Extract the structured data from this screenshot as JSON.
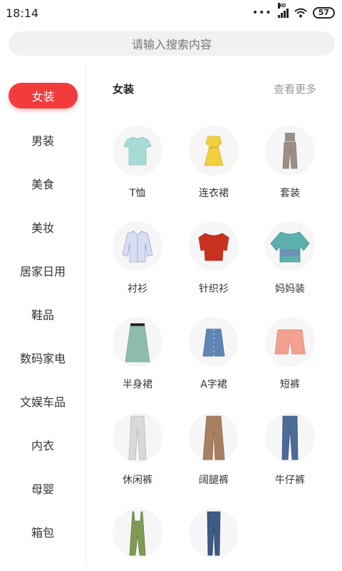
{
  "status": {
    "time": "18:14",
    "network": "HD",
    "battery": "57"
  },
  "search": {
    "placeholder": "请输入搜索内容"
  },
  "sidebar": {
    "items": [
      {
        "label": "女装",
        "active": true
      },
      {
        "label": "男装"
      },
      {
        "label": "美食"
      },
      {
        "label": "美妆"
      },
      {
        "label": "居家日用"
      },
      {
        "label": "鞋品"
      },
      {
        "label": "数码家电"
      },
      {
        "label": "文娱车品"
      },
      {
        "label": "内衣"
      },
      {
        "label": "母婴"
      },
      {
        "label": "箱包"
      }
    ]
  },
  "content": {
    "title": "女装",
    "more": "查看更多",
    "categories": [
      {
        "label": "T恤",
        "icon": "tshirt-icon",
        "color": "#a7dbd6"
      },
      {
        "label": "连衣裙",
        "icon": "dress-icon",
        "color": "#f2cf3f"
      },
      {
        "label": "套装",
        "icon": "set-icon",
        "color": "#9a8f86"
      },
      {
        "label": "衬衫",
        "icon": "shirt-icon",
        "color": "#d9ddf2"
      },
      {
        "label": "针织衫",
        "icon": "knit-icon",
        "color": "#c8321e"
      },
      {
        "label": "妈妈装",
        "icon": "blouse-icon",
        "color": "#5eb0ae"
      },
      {
        "label": "半身裙",
        "icon": "skirt-icon",
        "color": "#8fbcad"
      },
      {
        "label": "A字裙",
        "icon": "aline-skirt-icon",
        "color": "#5f86b5"
      },
      {
        "label": "短裤",
        "icon": "shorts-icon",
        "color": "#f3a08f"
      },
      {
        "label": "休闲裤",
        "icon": "pants-icon",
        "color": "#d9d9d9"
      },
      {
        "label": "阔腿裤",
        "icon": "wide-pants-icon",
        "color": "#a88060"
      },
      {
        "label": "牛仔裤",
        "icon": "jeans-icon",
        "color": "#4c6b97"
      },
      {
        "label": "",
        "icon": "jumpsuit-icon",
        "color": "#7f9b55"
      },
      {
        "label": "",
        "icon": "jeans-icon",
        "color": "#3f5a85"
      }
    ]
  }
}
